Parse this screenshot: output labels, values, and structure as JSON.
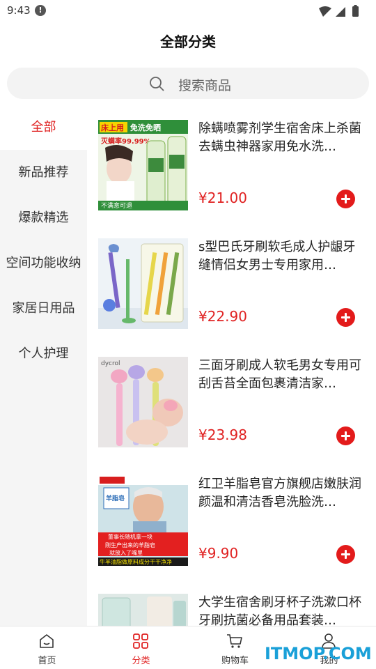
{
  "status_bar": {
    "time": "9:43",
    "alert_icon": "alert-circle-icon"
  },
  "header": {
    "title": "全部分类"
  },
  "search": {
    "placeholder": "搜索商品",
    "icon": "search-icon"
  },
  "sidebar": {
    "items": [
      {
        "label": "全部",
        "active": true
      },
      {
        "label": "新品推荐",
        "active": false
      },
      {
        "label": "爆款精选",
        "active": false
      },
      {
        "label": "空间功能收纳",
        "active": false
      },
      {
        "label": "家居日用品",
        "active": false
      },
      {
        "label": "个人护理",
        "active": false
      }
    ]
  },
  "products": [
    {
      "title": "除螨喷雾剂学生宿舍床上杀菌去螨虫神器家用免水洗…",
      "price": "¥21.00",
      "image_text": {
        "banner": "床上用",
        "tag": "免洗免晒",
        "rate": "灭螨率99.99%",
        "bottom": "不满意可退"
      }
    },
    {
      "title": "s型巴氏牙刷软毛成人护龈牙缝情侣女男士专用家用…",
      "price": "¥22.90"
    },
    {
      "title": "三面牙刷成人软毛男女专用可刮舌苔全面包裹清洁家…",
      "price": "¥23.98",
      "image_text": {
        "brand": "dycrol"
      }
    },
    {
      "title": "红卫羊脂皂官方旗舰店嫩肤润颜温和清洁香皂洗脸洗…",
      "price": "¥9.90",
      "image_text": {
        "box": "羊脂皂",
        "caption": "董事长随机拿一块",
        "caption2": "刚生产出来的羊脂皂",
        "caption3": "就放入了嘴里",
        "bottom": "牛羊油脂做原料成分干干净净"
      }
    },
    {
      "title": "大学生宿舍刷牙杯子洗漱口杯牙刷抗菌必备用品套装…",
      "price": ""
    }
  ],
  "tabbar": {
    "tabs": [
      {
        "label": "首页",
        "icon": "home-icon",
        "active": false
      },
      {
        "label": "分类",
        "icon": "category-grid-icon",
        "active": true
      },
      {
        "label": "购物车",
        "icon": "cart-icon",
        "active": false
      },
      {
        "label": "我的",
        "icon": "profile-icon",
        "active": false
      }
    ]
  },
  "watermark": {
    "text": "ITMOP.COM"
  },
  "colors": {
    "accent": "#e02222",
    "add_button": "#e31b1b",
    "sidebar_bg": "#f5f5f5",
    "search_bg": "#f3f3f3"
  }
}
